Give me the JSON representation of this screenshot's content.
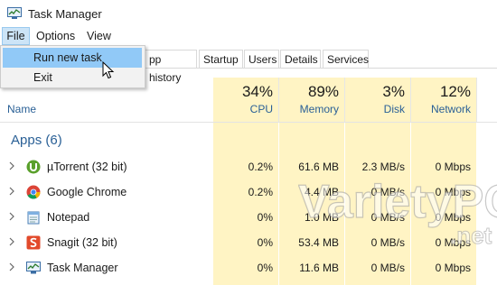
{
  "window": {
    "title": "Task Manager"
  },
  "menubar": {
    "file": "File",
    "options": "Options",
    "view": "View"
  },
  "file_menu": {
    "items": [
      "Run new task",
      "Exit"
    ]
  },
  "tabs": [
    "pp history",
    "Startup",
    "Users",
    "Details",
    "Services"
  ],
  "header": {
    "name_label": "Name",
    "columns": [
      {
        "pct": "34%",
        "label": "CPU"
      },
      {
        "pct": "89%",
        "label": "Memory"
      },
      {
        "pct": "3%",
        "label": "Disk"
      },
      {
        "pct": "12%",
        "label": "Network"
      }
    ]
  },
  "group": {
    "label": "Apps (6)"
  },
  "processes": [
    {
      "name": "µTorrent (32 bit)",
      "icon": "utorrent-icon",
      "cpu": "0.2%",
      "memory": "61.6 MB",
      "disk": "2.3 MB/s",
      "network": "0 Mbps"
    },
    {
      "name": "Google Chrome",
      "icon": "chrome-icon",
      "cpu": "0.2%",
      "memory": "4.4 MB",
      "disk": "0 MB/s",
      "network": "0 Mbps"
    },
    {
      "name": "Notepad",
      "icon": "notepad-icon",
      "cpu": "0%",
      "memory": "1.0 MB",
      "disk": "0 MB/s",
      "network": "0 Mbps"
    },
    {
      "name": "Snagit (32 bit)",
      "icon": "snagit-icon",
      "cpu": "0%",
      "memory": "53.4 MB",
      "disk": "0 MB/s",
      "network": "0 Mbps"
    },
    {
      "name": "Task Manager",
      "icon": "taskmanager-icon",
      "cpu": "0%",
      "memory": "11.6 MB",
      "disk": "0 MB/s",
      "network": "0 Mbps"
    }
  ],
  "watermark": {
    "text": "VarietyPC",
    "suffix": ".net"
  },
  "colors": {
    "accent": "#2a6096",
    "heat": "#fff4c4",
    "highlight": "#91c9f7"
  }
}
